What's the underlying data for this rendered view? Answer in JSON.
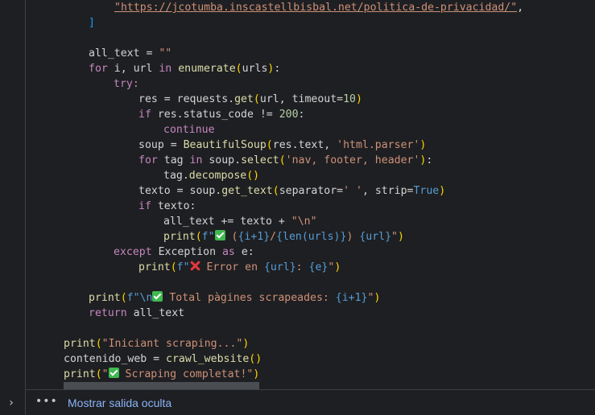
{
  "code_lines": {
    "l0_url": "\"https://jcotumba.inscastellbisbal.net/politica-de-privacidad/\"",
    "l0_comma": ",",
    "l1": "]",
    "l3_a": "all_text = ",
    "l3_b": "\"\"",
    "l4_for": "for",
    "l4_a": " i, url ",
    "l4_in": "in",
    "l4_fn": "enumerate",
    "l4_b": "urls",
    "l4_c": ":",
    "l5": "try:",
    "l6_a": "res = requests.",
    "l6_fn": "get",
    "l6_b": "url, timeout=",
    "l6_num": "10",
    "l7_if": "if",
    "l7_a": " res.status_code != ",
    "l7_num": "200",
    "l7_b": ":",
    "l8": "continue",
    "l9_a": "soup = ",
    "l9_fn": "BeautifulSoup",
    "l9_b": "res.text, ",
    "l9_str": "'html.parser'",
    "l10_for": "for",
    "l10_a": " tag ",
    "l10_in": "in",
    "l10_b": " soup.",
    "l10_fn": "select",
    "l10_str": "'nav, footer, header'",
    "l10_c": ":",
    "l11_a": "tag.",
    "l11_fn": "decompose",
    "l12_a": "texto = soup.",
    "l12_fn": "get_text",
    "l12_b": "separator=",
    "l12_str": "' '",
    "l12_c": ", strip=",
    "l12_true": "True",
    "l13_if": "if",
    "l13_a": " texto:",
    "l14_a": "all_text += texto + ",
    "l14_str": "\"\\n\"",
    "l15_fn": "print",
    "l15_f": "f\"",
    "l15_s1": " (",
    "l15_s2": "{i+1}",
    "l15_s3": "/",
    "l15_s4": "{len(urls)}",
    "l15_s5": ") ",
    "l15_s6": "{url}",
    "l15_s7": "\"",
    "l16_ex": "except",
    "l16_a": " Exception ",
    "l16_as": "as",
    "l16_b": " e:",
    "l17_fn": "print",
    "l17_f": "f\"",
    "l17_s1": " Error en ",
    "l17_s2": "{url}",
    "l17_s3": ": ",
    "l17_s4": "{e}",
    "l17_s5": "\"",
    "l19_fn": "print",
    "l19_f": "f\"\\n",
    "l19_s1": " Total pàgines scrapeades: ",
    "l19_s2": "{i+1}",
    "l19_s3": "\"",
    "l20_ret": "return",
    "l20_a": " all_text",
    "l22_fn": "print",
    "l22_str": "\"Iniciant scraping...\"",
    "l23_a": "contenido_web = ",
    "l23_fn": "crawl_website",
    "l24_fn": "print",
    "l24_q1": "\"",
    "l24_s": " Scraping completat!",
    "l24_q2": "\""
  },
  "output": {
    "more_icon": "•••",
    "show_hidden_output": "Mostrar salida oculta"
  },
  "icons": {
    "expand": "chevron-right-icon"
  }
}
